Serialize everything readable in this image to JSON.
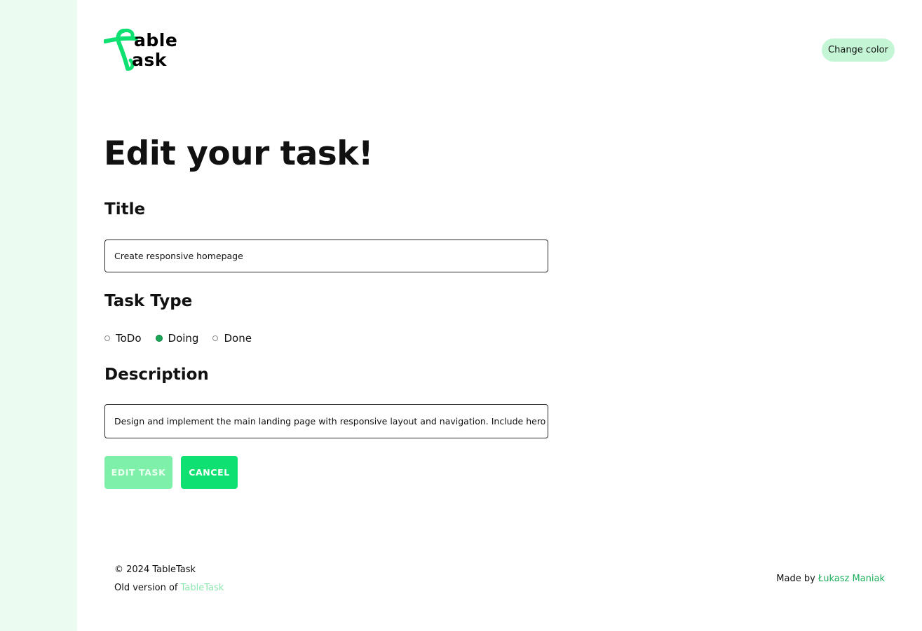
{
  "logo": {
    "line1": "able",
    "line2": "ask",
    "color": "#0ee071"
  },
  "header": {
    "change_color_label": "Change color"
  },
  "page": {
    "title": "Edit your task!"
  },
  "form": {
    "title_label": "Title",
    "title_value": "Create responsive homepage",
    "task_type_label": "Task Type",
    "task_types": [
      {
        "label": "ToDo",
        "checked": false
      },
      {
        "label": "Doing",
        "checked": true
      },
      {
        "label": "Done",
        "checked": false
      }
    ],
    "description_label": "Description",
    "description_value": "Design and implement the main landing page with responsive layout and navigation. Include hero sectio",
    "edit_button_label": "EDIT TASK",
    "cancel_button_label": "CANCEL"
  },
  "footer": {
    "copyright": "© 2024 TableTask",
    "old_version_prefix": "Old version of ",
    "old_version_link": "TableTask",
    "made_by_prefix": "Made by ",
    "author": "Łukasz Maniak"
  },
  "colors": {
    "accent": "#0ee071",
    "accent_light": "#7ff0a9",
    "sidebar_bg": "#ecfbf1",
    "pill_bg": "#c4f6d6"
  }
}
